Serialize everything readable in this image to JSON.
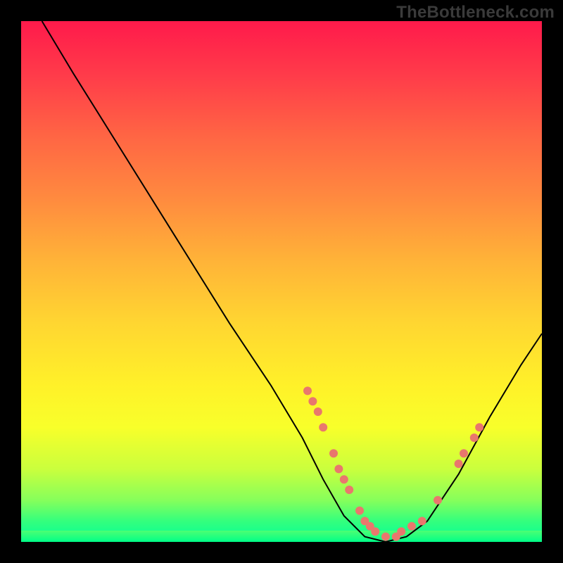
{
  "watermark": "TheBottleneck.com",
  "chart_data": {
    "type": "line",
    "title": "",
    "xlabel": "",
    "ylabel": "",
    "xlim": [
      0,
      100
    ],
    "ylim": [
      0,
      100
    ],
    "grid": false,
    "legend": false,
    "curve": [
      {
        "x": 4,
        "y": 100
      },
      {
        "x": 10,
        "y": 90
      },
      {
        "x": 20,
        "y": 74
      },
      {
        "x": 30,
        "y": 58
      },
      {
        "x": 40,
        "y": 42
      },
      {
        "x": 48,
        "y": 30
      },
      {
        "x": 54,
        "y": 20
      },
      {
        "x": 58,
        "y": 12
      },
      {
        "x": 62,
        "y": 5
      },
      {
        "x": 66,
        "y": 1
      },
      {
        "x": 70,
        "y": 0
      },
      {
        "x": 74,
        "y": 1
      },
      {
        "x": 78,
        "y": 4
      },
      {
        "x": 84,
        "y": 13
      },
      {
        "x": 90,
        "y": 24
      },
      {
        "x": 96,
        "y": 34
      },
      {
        "x": 100,
        "y": 40
      }
    ],
    "markers": [
      {
        "x": 55,
        "y": 29
      },
      {
        "x": 56,
        "y": 27
      },
      {
        "x": 57,
        "y": 25
      },
      {
        "x": 58,
        "y": 22
      },
      {
        "x": 60,
        "y": 17
      },
      {
        "x": 61,
        "y": 14
      },
      {
        "x": 62,
        "y": 12
      },
      {
        "x": 63,
        "y": 10
      },
      {
        "x": 65,
        "y": 6
      },
      {
        "x": 66,
        "y": 4
      },
      {
        "x": 67,
        "y": 3
      },
      {
        "x": 68,
        "y": 2
      },
      {
        "x": 70,
        "y": 1
      },
      {
        "x": 72,
        "y": 1
      },
      {
        "x": 73,
        "y": 2
      },
      {
        "x": 75,
        "y": 3
      },
      {
        "x": 77,
        "y": 4
      },
      {
        "x": 80,
        "y": 8
      },
      {
        "x": 84,
        "y": 15
      },
      {
        "x": 85,
        "y": 17
      },
      {
        "x": 87,
        "y": 20
      },
      {
        "x": 88,
        "y": 22
      }
    ],
    "gradient_stops": [
      {
        "pos": 0,
        "color": "#ff1a4b"
      },
      {
        "pos": 50,
        "color": "#ffd631"
      },
      {
        "pos": 100,
        "color": "#00ff99"
      }
    ]
  }
}
